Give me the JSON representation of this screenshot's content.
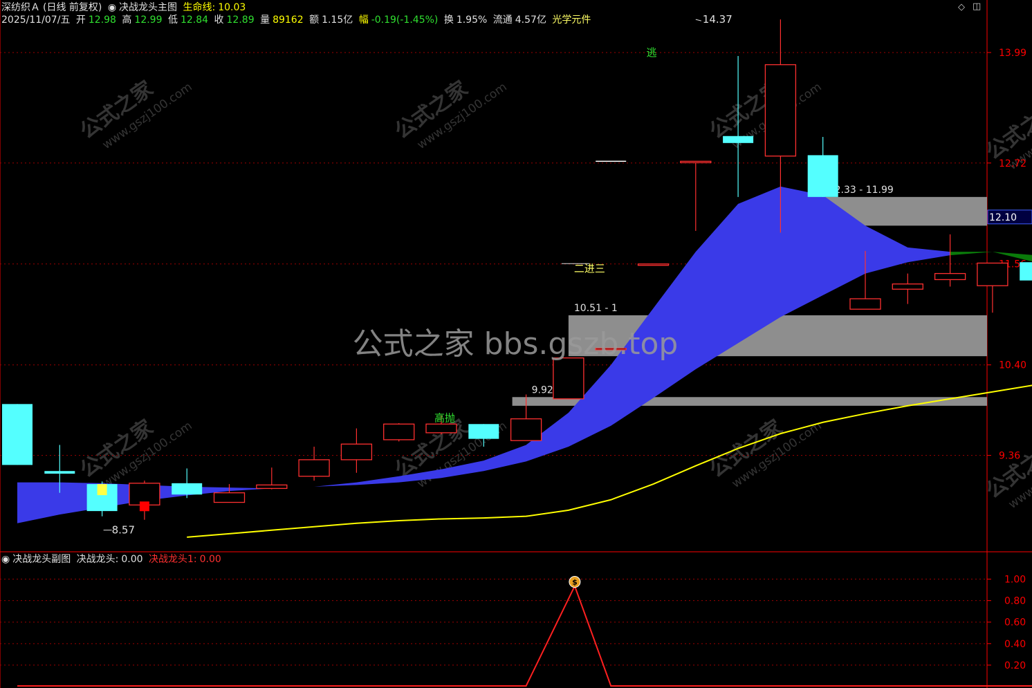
{
  "header": {
    "stock_name": "深纺织Ａ",
    "period": "(日线 前复权)",
    "main_indicator": "决战龙头主图",
    "life_line_label": "生命线:",
    "life_line_value": "10.03",
    "date": "2025/11/07/五",
    "open_label": "开",
    "open_value": "12.98",
    "high_label": "高",
    "high_value": "12.99",
    "low_label": "低",
    "low_value": "12.84",
    "close_label": "收",
    "close_value": "12.89",
    "volume_label": "量",
    "volume_value": "89162",
    "amount_label": "额",
    "amount_value": "1.15亿",
    "range_label": "幅",
    "range_value": "-0.19(-1.45%)",
    "turnover_label": "换",
    "turnover_value": "1.95%",
    "float_label": "流通",
    "float_value": "4.57亿",
    "sector": "光学元件"
  },
  "sub_header": {
    "name": "决战龙头副图",
    "series1_label": "决战龙头:",
    "series1_value": "0.00",
    "series2_label": "决战龙头1:",
    "series2_value": "0.00"
  },
  "watermark": {
    "center_text": "公式之家 bbs.gszb.top",
    "tile_cn": "公式之家",
    "tile_url": "www.gszj100.com"
  },
  "colors": {
    "up": "#ff3030",
    "down": "#54ffff",
    "ribbon_up": "#3a3ae8",
    "ribbon_down": "#0a7a0a",
    "life_line": "#ffff00",
    "zone": "#8e8e8e",
    "grid": "#a00000",
    "axis": "#ff0000",
    "sub_line": "#ff2020"
  },
  "chart_data": [
    {
      "type": "candlestick",
      "ylim": [
        8.26,
        14.53
      ],
      "y_ticks": [
        9.36,
        10.4,
        11.56,
        12.72,
        13.99
      ],
      "current_price_tag": 12.1,
      "candles": [
        {
          "o": 9.95,
          "h": 9.95,
          "l": 9.25,
          "c": 9.25
        },
        {
          "o": 9.18,
          "h": 9.48,
          "l": 8.93,
          "c": 9.15
        },
        {
          "o": 9.03,
          "h": 9.06,
          "l": 8.66,
          "c": 8.72
        },
        {
          "o": 8.79,
          "h": 9.07,
          "l": 8.62,
          "c": 9.04
        },
        {
          "o": 9.04,
          "h": 9.21,
          "l": 8.87,
          "c": 8.91
        },
        {
          "o": 8.82,
          "h": 9.03,
          "l": 8.82,
          "c": 8.93
        },
        {
          "o": 8.98,
          "h": 9.22,
          "l": 8.97,
          "c": 9.02
        },
        {
          "o": 9.12,
          "h": 9.46,
          "l": 9.07,
          "c": 9.31
        },
        {
          "o": 9.31,
          "h": 9.67,
          "l": 9.16,
          "c": 9.49
        },
        {
          "o": 9.54,
          "h": 9.73,
          "l": 9.52,
          "c": 9.72
        },
        {
          "o": 9.62,
          "h": 9.82,
          "l": 9.6,
          "c": 9.72
        },
        {
          "o": 9.72,
          "h": 9.72,
          "l": 9.46,
          "c": 9.55
        },
        {
          "o": 9.53,
          "h": 10.06,
          "l": 9.53,
          "c": 9.78
        },
        {
          "o": 10.01,
          "h": 10.0,
          "l": 10.0,
          "c": 10.48
        },
        {
          "o": 10.59,
          "h": 10.59,
          "l": 10.59,
          "c": 10.59
        },
        {
          "o": 11.56,
          "h": 11.56,
          "l": 11.56,
          "c": 11.56
        },
        {
          "o": 12.74,
          "h": 12.74,
          "l": 11.94,
          "c": 12.74
        },
        {
          "o": 13.03,
          "h": 13.95,
          "l": 12.33,
          "c": 12.95
        },
        {
          "o": 12.8,
          "h": 14.37,
          "l": 11.92,
          "c": 13.85
        },
        {
          "o": 12.81,
          "h": 13.02,
          "l": 12.33,
          "c": 12.33
        },
        {
          "o": 11.04,
          "h": 11.71,
          "l": 11.04,
          "c": 11.16
        },
        {
          "o": 11.27,
          "h": 11.45,
          "l": 11.1,
          "c": 11.33
        },
        {
          "o": 11.38,
          "h": 11.9,
          "l": 11.3,
          "c": 11.45
        },
        {
          "o": 11.31,
          "h": 11.57,
          "l": 11.0,
          "c": 11.57
        },
        {
          "o": 11.58,
          "h": 11.76,
          "l": 11.32,
          "c": 11.37
        }
      ],
      "ribbon_fast": [
        9.05,
        9.05,
        9.04,
        9.02,
        9.0,
        8.99,
        8.98,
        9.0,
        9.05,
        9.12,
        9.2,
        9.3,
        9.48,
        9.85,
        10.4,
        11.05,
        11.7,
        12.25,
        12.45,
        12.35,
        12.0,
        11.75,
        11.7,
        11.7,
        11.58
      ],
      "ribbon_slow": [
        8.58,
        8.68,
        8.76,
        8.84,
        8.9,
        8.95,
        8.98,
        9.0,
        9.02,
        9.05,
        9.1,
        9.18,
        9.29,
        9.46,
        9.7,
        10.02,
        10.35,
        10.65,
        10.95,
        11.2,
        11.45,
        11.58,
        11.66,
        11.7,
        11.66
      ],
      "life_line": [
        null,
        null,
        null,
        null,
        8.42,
        8.46,
        8.5,
        8.54,
        8.58,
        8.61,
        8.63,
        8.64,
        8.66,
        8.73,
        8.85,
        9.03,
        9.24,
        9.44,
        9.61,
        9.74,
        9.84,
        9.93,
        10.01,
        10.09,
        10.17
      ],
      "zones": [
        {
          "from": 12.0,
          "to": 12.33,
          "start": 18,
          "label": "12.33 - 11.99",
          "label_at": 19
        },
        {
          "from": 10.5,
          "to": 10.97,
          "start": 13,
          "label": "10.51 - 1",
          "label_at": 13
        },
        {
          "from": 9.93,
          "to": 10.03,
          "start": 12,
          "label": "9.92 - 10",
          "label_at": 12
        }
      ],
      "annotations": [
        {
          "text": "逃",
          "index": 15,
          "price": 13.95,
          "color": "#30e030"
        },
        {
          "text": "高抛",
          "index": 10,
          "price": 9.75,
          "color": "#30e030"
        },
        {
          "text": "二进三",
          "index": 13,
          "price": 11.5,
          "color": "#ffff66"
        },
        {
          "text": "14.37",
          "index": 16,
          "price": 14.37,
          "color": "#e0e0e0",
          "marker": "high"
        },
        {
          "text": "8.57",
          "index": 2,
          "price": 8.62,
          "color": "#e0e0e0",
          "marker": "low"
        }
      ]
    },
    {
      "type": "line",
      "ylim": [
        0,
        1.1
      ],
      "y_ticks": [
        0.2,
        0.4,
        0.6,
        0.8,
        1.0
      ],
      "series": [
        {
          "name": "决战龙头1",
          "values": [
            0,
            0,
            0,
            0,
            0,
            0,
            0,
            0,
            0,
            0,
            0,
            0,
            0,
            1,
            0,
            0,
            0,
            0,
            0,
            0,
            0,
            0,
            0,
            0,
            0
          ]
        }
      ],
      "signal_index": 13
    }
  ]
}
